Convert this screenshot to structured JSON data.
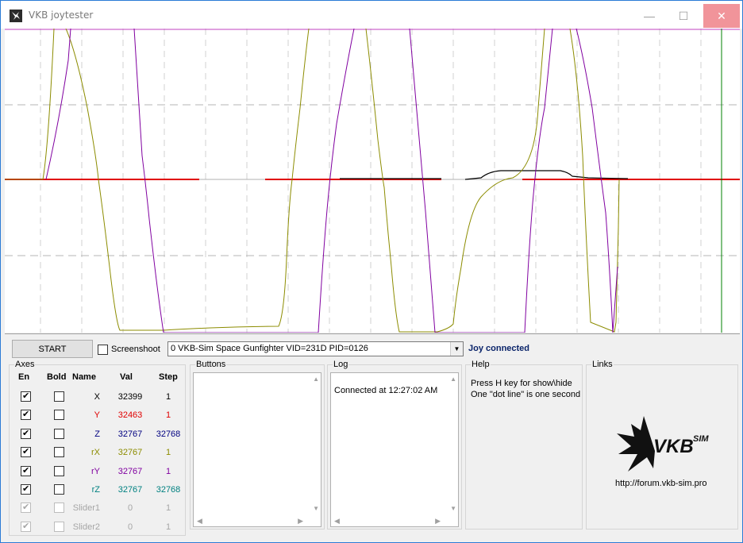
{
  "window": {
    "title": "VKB joytester",
    "icon": "vkb-bird-icon",
    "controls": {
      "minimize": "—",
      "maximize": "☐",
      "close": "✕"
    }
  },
  "toolbar": {
    "start_label": "START",
    "screenshot_label": "Screenshoot",
    "screenshot_checked": false,
    "device_selected": "0  VKB-Sim Space Gunfighter  VID=231D PID=0126",
    "status": "Joy connected"
  },
  "axes": {
    "title": "Axes",
    "headers": {
      "en": "En",
      "bold": "Bold",
      "name": "Name",
      "val": "Val",
      "step": "Step"
    },
    "rows": [
      {
        "name": "X",
        "val": "32399",
        "step": "1",
        "en": true,
        "bold": false,
        "color": "#000000",
        "disabled": false
      },
      {
        "name": "Y",
        "val": "32463",
        "step": "1",
        "en": true,
        "bold": false,
        "color": "#e00000",
        "disabled": false
      },
      {
        "name": "Z",
        "val": "32767",
        "step": "32768",
        "en": true,
        "bold": false,
        "color": "#000080",
        "disabled": false
      },
      {
        "name": "rX",
        "val": "32767",
        "step": "1",
        "en": true,
        "bold": false,
        "color": "#8c8c00",
        "disabled": false
      },
      {
        "name": "rY",
        "val": "32767",
        "step": "1",
        "en": true,
        "bold": false,
        "color": "#8000a0",
        "disabled": false
      },
      {
        "name": "rZ",
        "val": "32767",
        "step": "32768",
        "en": true,
        "bold": false,
        "color": "#008080",
        "disabled": false
      },
      {
        "name": "Slider1",
        "val": "0",
        "step": "1",
        "en": true,
        "bold": false,
        "color": "#a6a6a6",
        "disabled": true
      },
      {
        "name": "Slider2",
        "val": "0",
        "step": "1",
        "en": true,
        "bold": false,
        "color": "#a6a6a6",
        "disabled": true
      }
    ]
  },
  "buttons_group": {
    "title": "Buttons"
  },
  "log": {
    "title": "Log",
    "lines": [
      "Connected at 12:27:02 AM"
    ]
  },
  "help": {
    "title": "Help",
    "lines": [
      "Press H key for show\\hide",
      "One \"dot line\" is one second"
    ]
  },
  "links": {
    "title": "Links",
    "logo": "vkb-sim-logo",
    "logo_text": "VKB",
    "logo_sup": "SIM",
    "url": "http://forum.vkb-sim.pro"
  },
  "scope_colors": {
    "rX": "#8c8c00",
    "rY": "#8000a0",
    "X": "#000000",
    "Y": "#e00000",
    "Z": "#808080",
    "marker": "#008000"
  }
}
